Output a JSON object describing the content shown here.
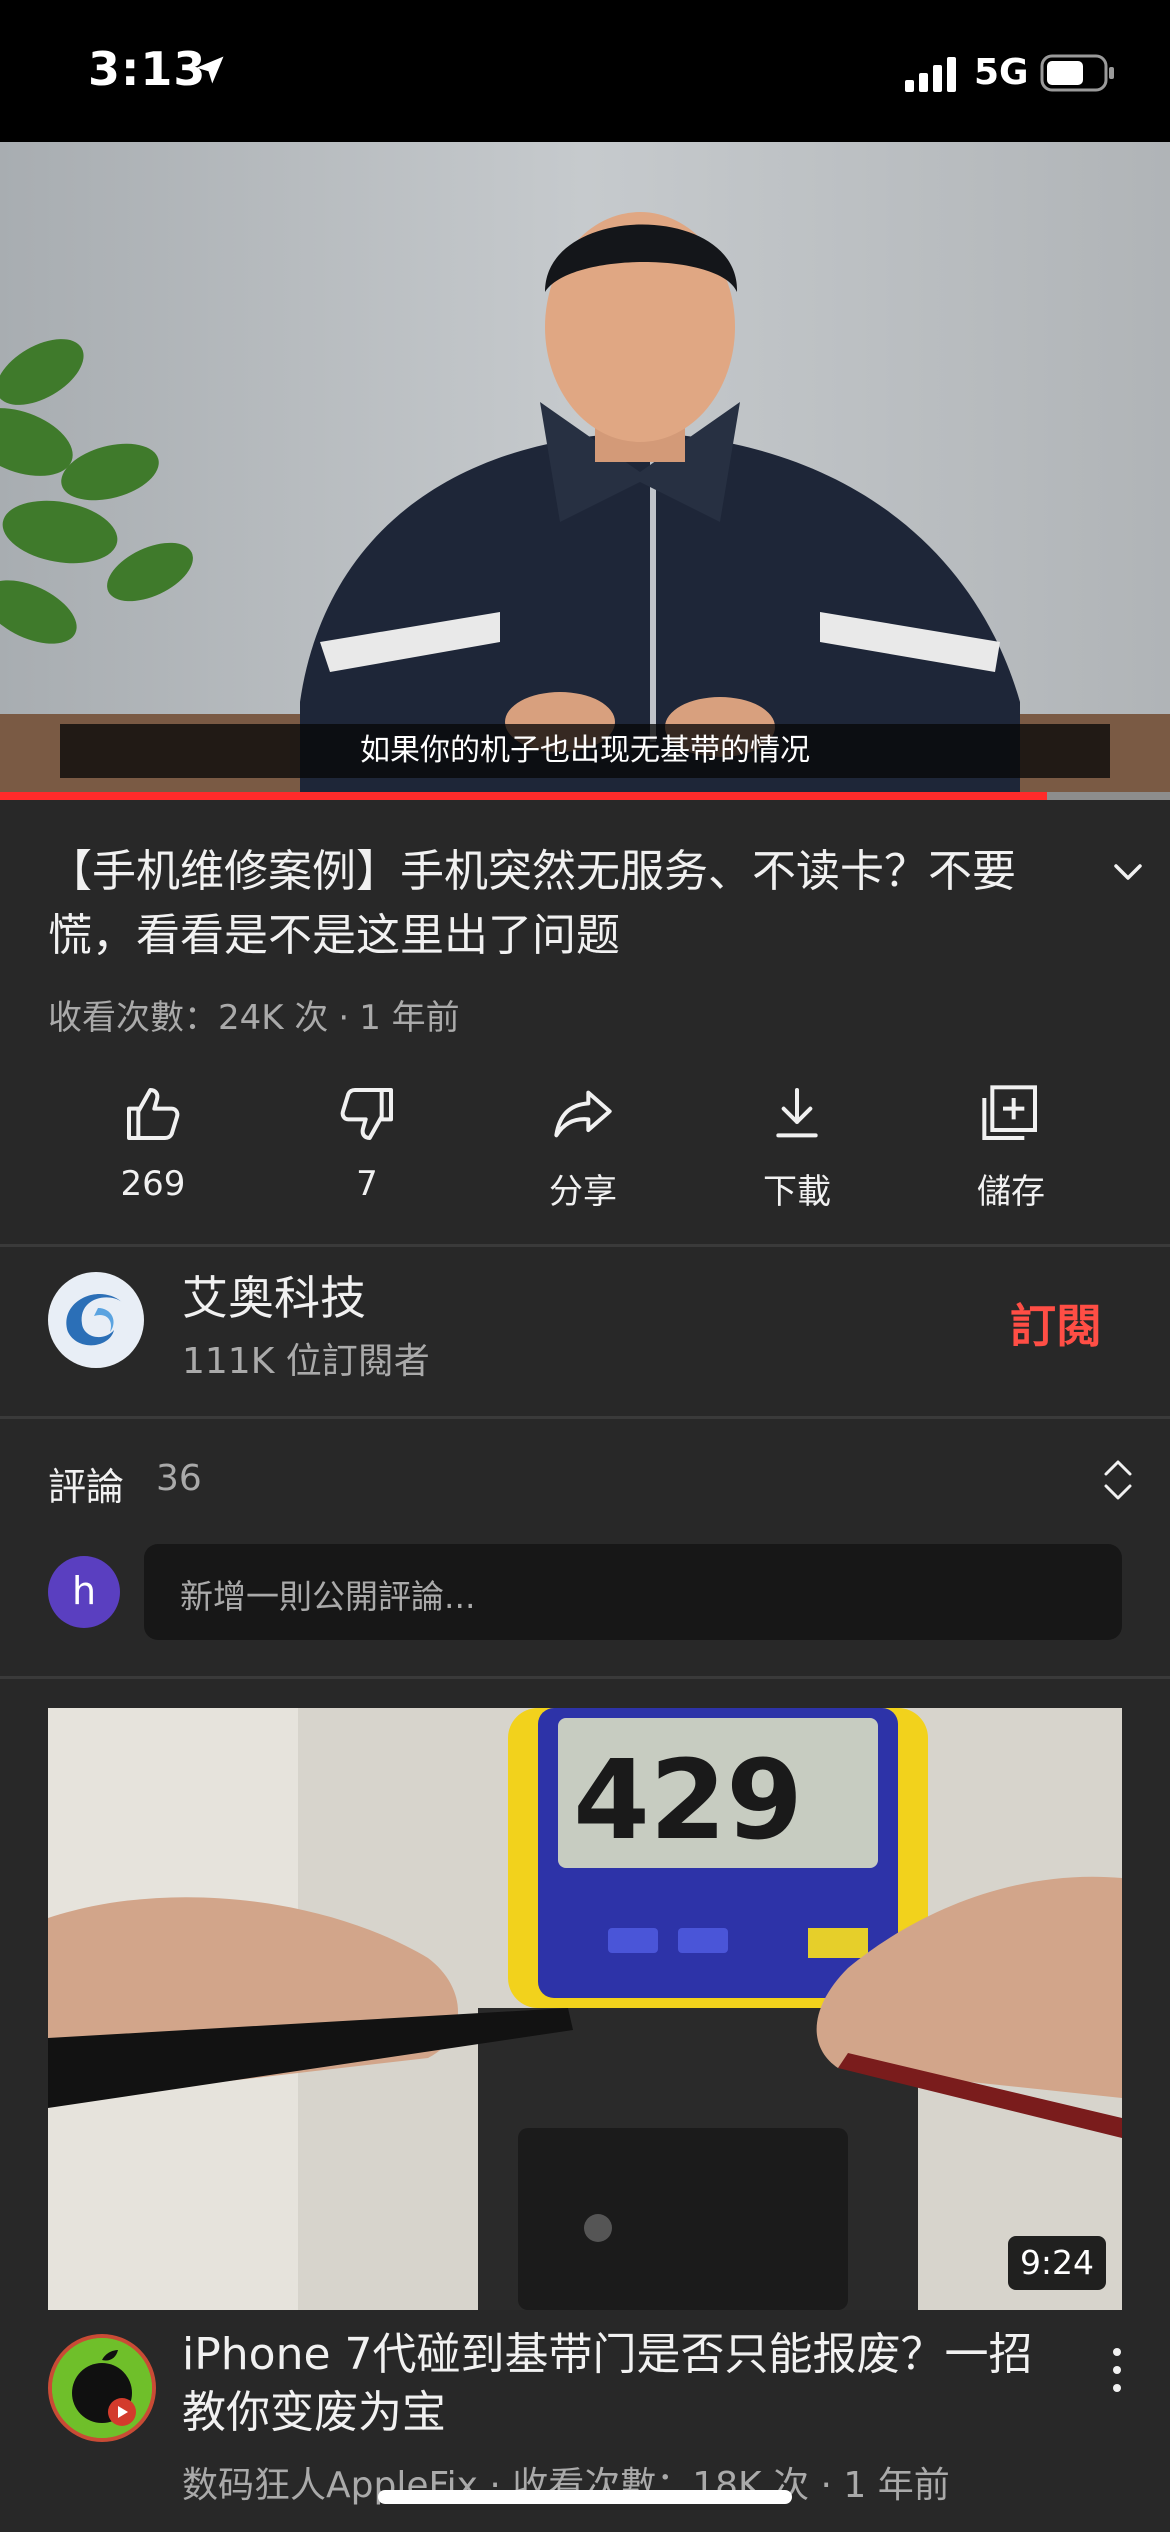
{
  "status_bar": {
    "time": "3:13",
    "network": "5G",
    "icons": [
      "location-arrow-icon",
      "signal-icon",
      "battery-icon"
    ]
  },
  "player": {
    "subtitle": "如果你的机子也出现无基带的情况",
    "progress": 0.895,
    "colors": {
      "progress": "#ff2b2b",
      "track": "#8d8d8d"
    }
  },
  "video": {
    "title": "【手机维修案例】手机突然无服务、不读卡？不要慌，看看是不是这里出了问题",
    "views": "收看次數：24K 次",
    "separator": "·",
    "age": "1 年前"
  },
  "actions": {
    "like": {
      "label": "269",
      "icon": "thumbs-up-icon"
    },
    "dislike": {
      "label": "7",
      "icon": "thumbs-down-icon"
    },
    "share": {
      "label": "分享",
      "icon": "share-icon"
    },
    "download": {
      "label": "下載",
      "icon": "download-icon"
    },
    "save": {
      "label": "儲存",
      "icon": "save-playlist-icon"
    }
  },
  "channel": {
    "name": "艾奥科技",
    "subscribers": "111K 位訂閱者",
    "subscribe_label": "訂閱",
    "subscribe_color": "#ff4e45"
  },
  "comments": {
    "label": "評論",
    "count": "36",
    "user_initial": "h",
    "placeholder": "新增一則公開評論..."
  },
  "next_video": {
    "duration": "9:24",
    "meter_reading": "429",
    "title": "iPhone 7代碰到基带门是否只能报废？一招教你变废为宝",
    "meta": "数码狂人AppleFix · 收看次數：18K 次 · 1 年前"
  }
}
